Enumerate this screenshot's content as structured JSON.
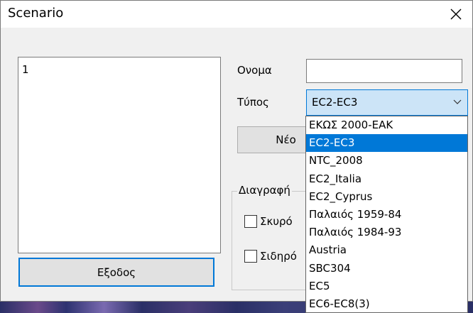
{
  "window": {
    "title": "Scenario"
  },
  "list": {
    "items": [
      "1"
    ]
  },
  "form": {
    "name_label": "Ονομα",
    "name_value": "",
    "type_label": "Τύπος",
    "type_value": "EC2-EC3",
    "new_button": "Νέο",
    "delete_group_label": "Διαγραφή",
    "concrete_checkbox": "Σκυρό",
    "steel_checkbox": "Σιδηρό",
    "exit_button": "Εξοδος"
  },
  "dropdown": {
    "selected_index": 1,
    "options": [
      "ΕΚΩΣ 2000-ΕΑΚ",
      "EC2-EC3",
      "NTC_2008",
      "EC2_Italia",
      "EC2_Cyprus",
      "Παλαιός 1959-84",
      "Παλαιός 1984-93",
      "Austria",
      "SBC304",
      "EC5",
      "EC6-EC8(3)"
    ]
  },
  "colors": {
    "accent": "#0078d7",
    "combo_bg": "#cce4f7",
    "dialog_bg": "#f0f0f0"
  }
}
